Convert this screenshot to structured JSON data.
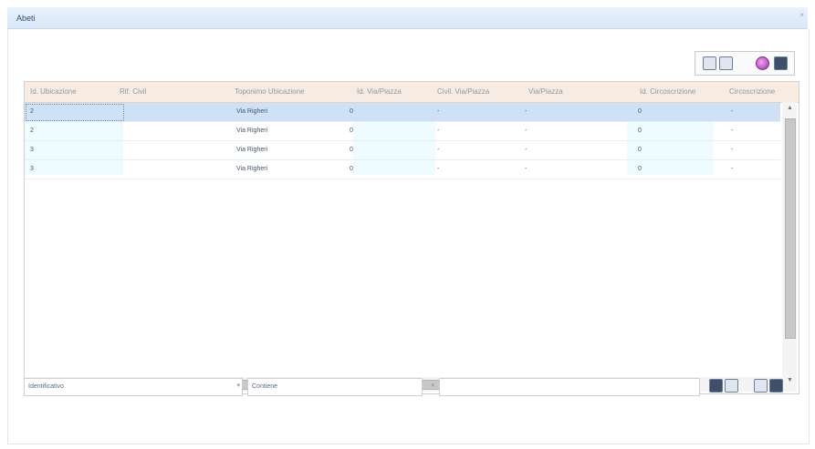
{
  "window": {
    "title": "Abeti",
    "close_glyph": "×"
  },
  "toolbar": {
    "icons": [
      "grid-export-icon",
      "check-grid-icon",
      "purple-ball-icon",
      "save-icon"
    ]
  },
  "grid": {
    "columns": [
      "Id. Ubicazione",
      "Rif. Civil",
      "Toponimo Ubicazione",
      "Id. Via/Piazza",
      "Civil. Via/Piazza",
      "Via/Piazza",
      "Id. Circoscrizione",
      "Circoscrizione"
    ],
    "rows": [
      [
        "2",
        "",
        "Via Righeri",
        "0",
        "-",
        "-",
        "0",
        "-"
      ],
      [
        "2",
        "",
        "Via Righeri",
        "0",
        "-",
        "-",
        "0",
        "-"
      ],
      [
        "3",
        "",
        "Via Righeri",
        "0",
        "-",
        "-",
        "0",
        "-"
      ],
      [
        "3",
        "",
        "Via Righeri",
        "0",
        "-",
        "-",
        "0",
        "-"
      ]
    ]
  },
  "filter": {
    "field_value": "Identificativo",
    "operator_value": "Contiene",
    "text_value": "",
    "dropdown_glyph": "▾"
  }
}
